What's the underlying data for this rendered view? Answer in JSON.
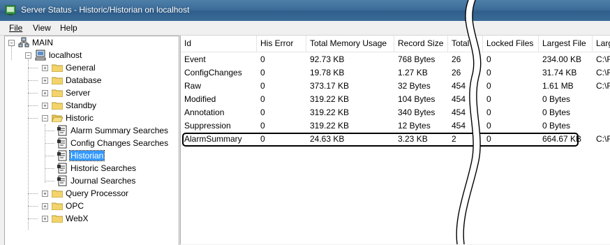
{
  "window": {
    "title": "Server Status - Historic/Historian on localhost"
  },
  "menu": {
    "file": "File",
    "view": "View",
    "help": "Help"
  },
  "tree": {
    "root": "MAIN",
    "server": "localhost",
    "items": {
      "general": "General",
      "database": "Database",
      "server": "Server",
      "standby": "Standby",
      "historic": "Historic",
      "alarm_summary_searches": "Alarm Summary Searches",
      "config_changes_searches": "Config Changes Searches",
      "historian": "Historian",
      "historic_searches": "Historic Searches",
      "journal_searches": "Journal Searches",
      "query_processor": "Query Processor",
      "opc": "OPC",
      "webx": "WebX"
    }
  },
  "table": {
    "columns": [
      "Id",
      "His Error",
      "Total Memory Usage",
      "Record Size",
      "Total",
      "Locked Files",
      "Largest File",
      "Larg"
    ],
    "rows": [
      [
        "Event",
        "0",
        "92.73 KB",
        "768 Bytes",
        "26",
        "0",
        "234.00 KB",
        "C:\\F"
      ],
      [
        "ConfigChanges",
        "0",
        "19.78 KB",
        "1.27 KB",
        "26",
        "0",
        "31.74 KB",
        "C:\\F"
      ],
      [
        "Raw",
        "0",
        "373.17 KB",
        "32 Bytes",
        "454",
        "0",
        "1.61 MB",
        "C:\\F"
      ],
      [
        "Modified",
        "0",
        "319.22 KB",
        "104 Bytes",
        "454",
        "0",
        "0 Bytes",
        ""
      ],
      [
        "Annotation",
        "0",
        "319.22 KB",
        "340 Bytes",
        "454",
        "0",
        "0 Bytes",
        ""
      ],
      [
        "Suppression",
        "0",
        "319.22 KB",
        "12 Bytes",
        "454",
        "0",
        "0 Bytes",
        ""
      ],
      [
        "AlarmSummary",
        "0",
        "24.63 KB",
        "3.23 KB",
        "2",
        "0",
        "664.67 KB",
        "C:\\F"
      ]
    ]
  },
  "colors": {
    "titlebar": "#3c6d99",
    "selection": "#3399ff",
    "folder": "#f3d36b"
  }
}
